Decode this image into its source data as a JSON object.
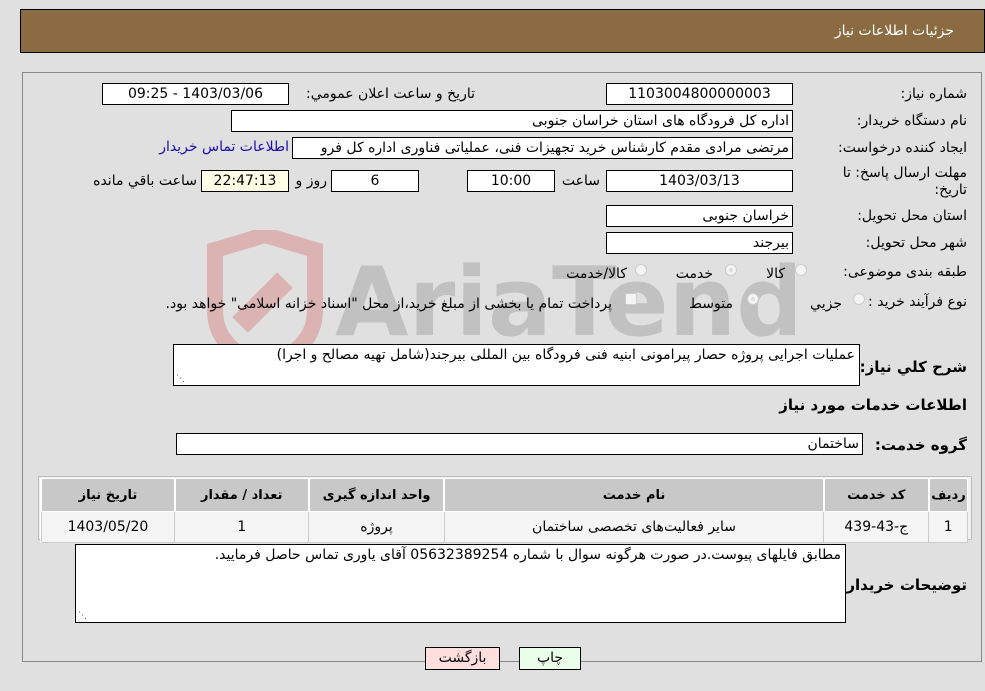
{
  "header": {
    "title": "جزئیات اطلاعات نیاز"
  },
  "fields": {
    "need_number": {
      "label": "شماره نیاز:",
      "value": "1103004800000003"
    },
    "announce_datetime": {
      "label": "تاریخ و ساعت اعلان عمومي:",
      "value": "1403/03/06 - 09:25"
    },
    "buyer_org": {
      "label": "نام دستگاه خریدار:",
      "value": "اداره کل فرودگاه های استان خراسان جنوبی"
    },
    "requester": {
      "label": "ایجاد کننده درخواست:",
      "value": "مرتضی مرادی مقدم کارشناس خرید تجهیزات فنی، عملیاتی فناوری اداره کل فرو"
    },
    "buyer_contact_link": "اطلاعات تماس خریدار",
    "deadline": {
      "label_line1": "مهلت ارسال پاسخ: تا",
      "label_line2": "تاریخ:",
      "date": "1403/03/13",
      "time_label": "ساعت",
      "time": "10:00",
      "days": "6",
      "days_label": "روز و",
      "remaining": "22:47:13",
      "remaining_label": "ساعت باقي مانده"
    },
    "delivery_province": {
      "label": "استان محل تحویل:",
      "value": "خراسان جنوبی"
    },
    "delivery_city": {
      "label": "شهر محل تحویل:",
      "value": "بیرجند"
    },
    "category": {
      "label": "طبقه بندی موضوعی:",
      "options": [
        "کالا",
        "خدمت",
        "کالا/خدمت"
      ],
      "selected": "خدمت"
    },
    "purchase_type": {
      "label": "نوع فرآیند خرید :",
      "options": [
        "جزيي",
        "متوسط"
      ],
      "selected": "متوسط",
      "treasury_note": "پرداخت تمام یا بخشی از مبلغ خرید،از محل \"اسناد خزانه اسلامی\" خواهد بود."
    }
  },
  "description": {
    "label": "شرح كلي نياز:",
    "value": "عملیات اجرایی پروژه حصار پیرامونی ابنیه فنی فرودگاه بین المللی بیرجند(شامل تهیه مصالح و اجرا)"
  },
  "services_section": {
    "title": "اطلاعات خدمات مورد نیاز"
  },
  "service_group": {
    "label": "گروه خدمت:",
    "value": "ساختمان"
  },
  "services_table": {
    "headers": [
      "ردیف",
      "کد خدمت",
      "نام خدمت",
      "واحد اندازه گیری",
      "تعداد / مقدار",
      "تاریخ نیاز"
    ],
    "rows": [
      [
        "1",
        "ج-43-439",
        "سایر فعالیت‌های تخصصی ساختمان",
        "پروژه",
        "1",
        "1403/05/20"
      ]
    ]
  },
  "buyer_notes": {
    "label": "توضیحات خریدار:",
    "value": "مطابق فایلهای پیوست.در صورت هرگونه سوال با شماره 05632389254 آقای یاوری تماس حاصل فرمایید."
  },
  "buttons": {
    "print": "چاپ",
    "back": "بازگشت"
  },
  "colors": {
    "header_bg": "#8b6c42",
    "back_btn": "#ffdede",
    "print_btn": "#eaffea",
    "link": "#1a0dab"
  }
}
